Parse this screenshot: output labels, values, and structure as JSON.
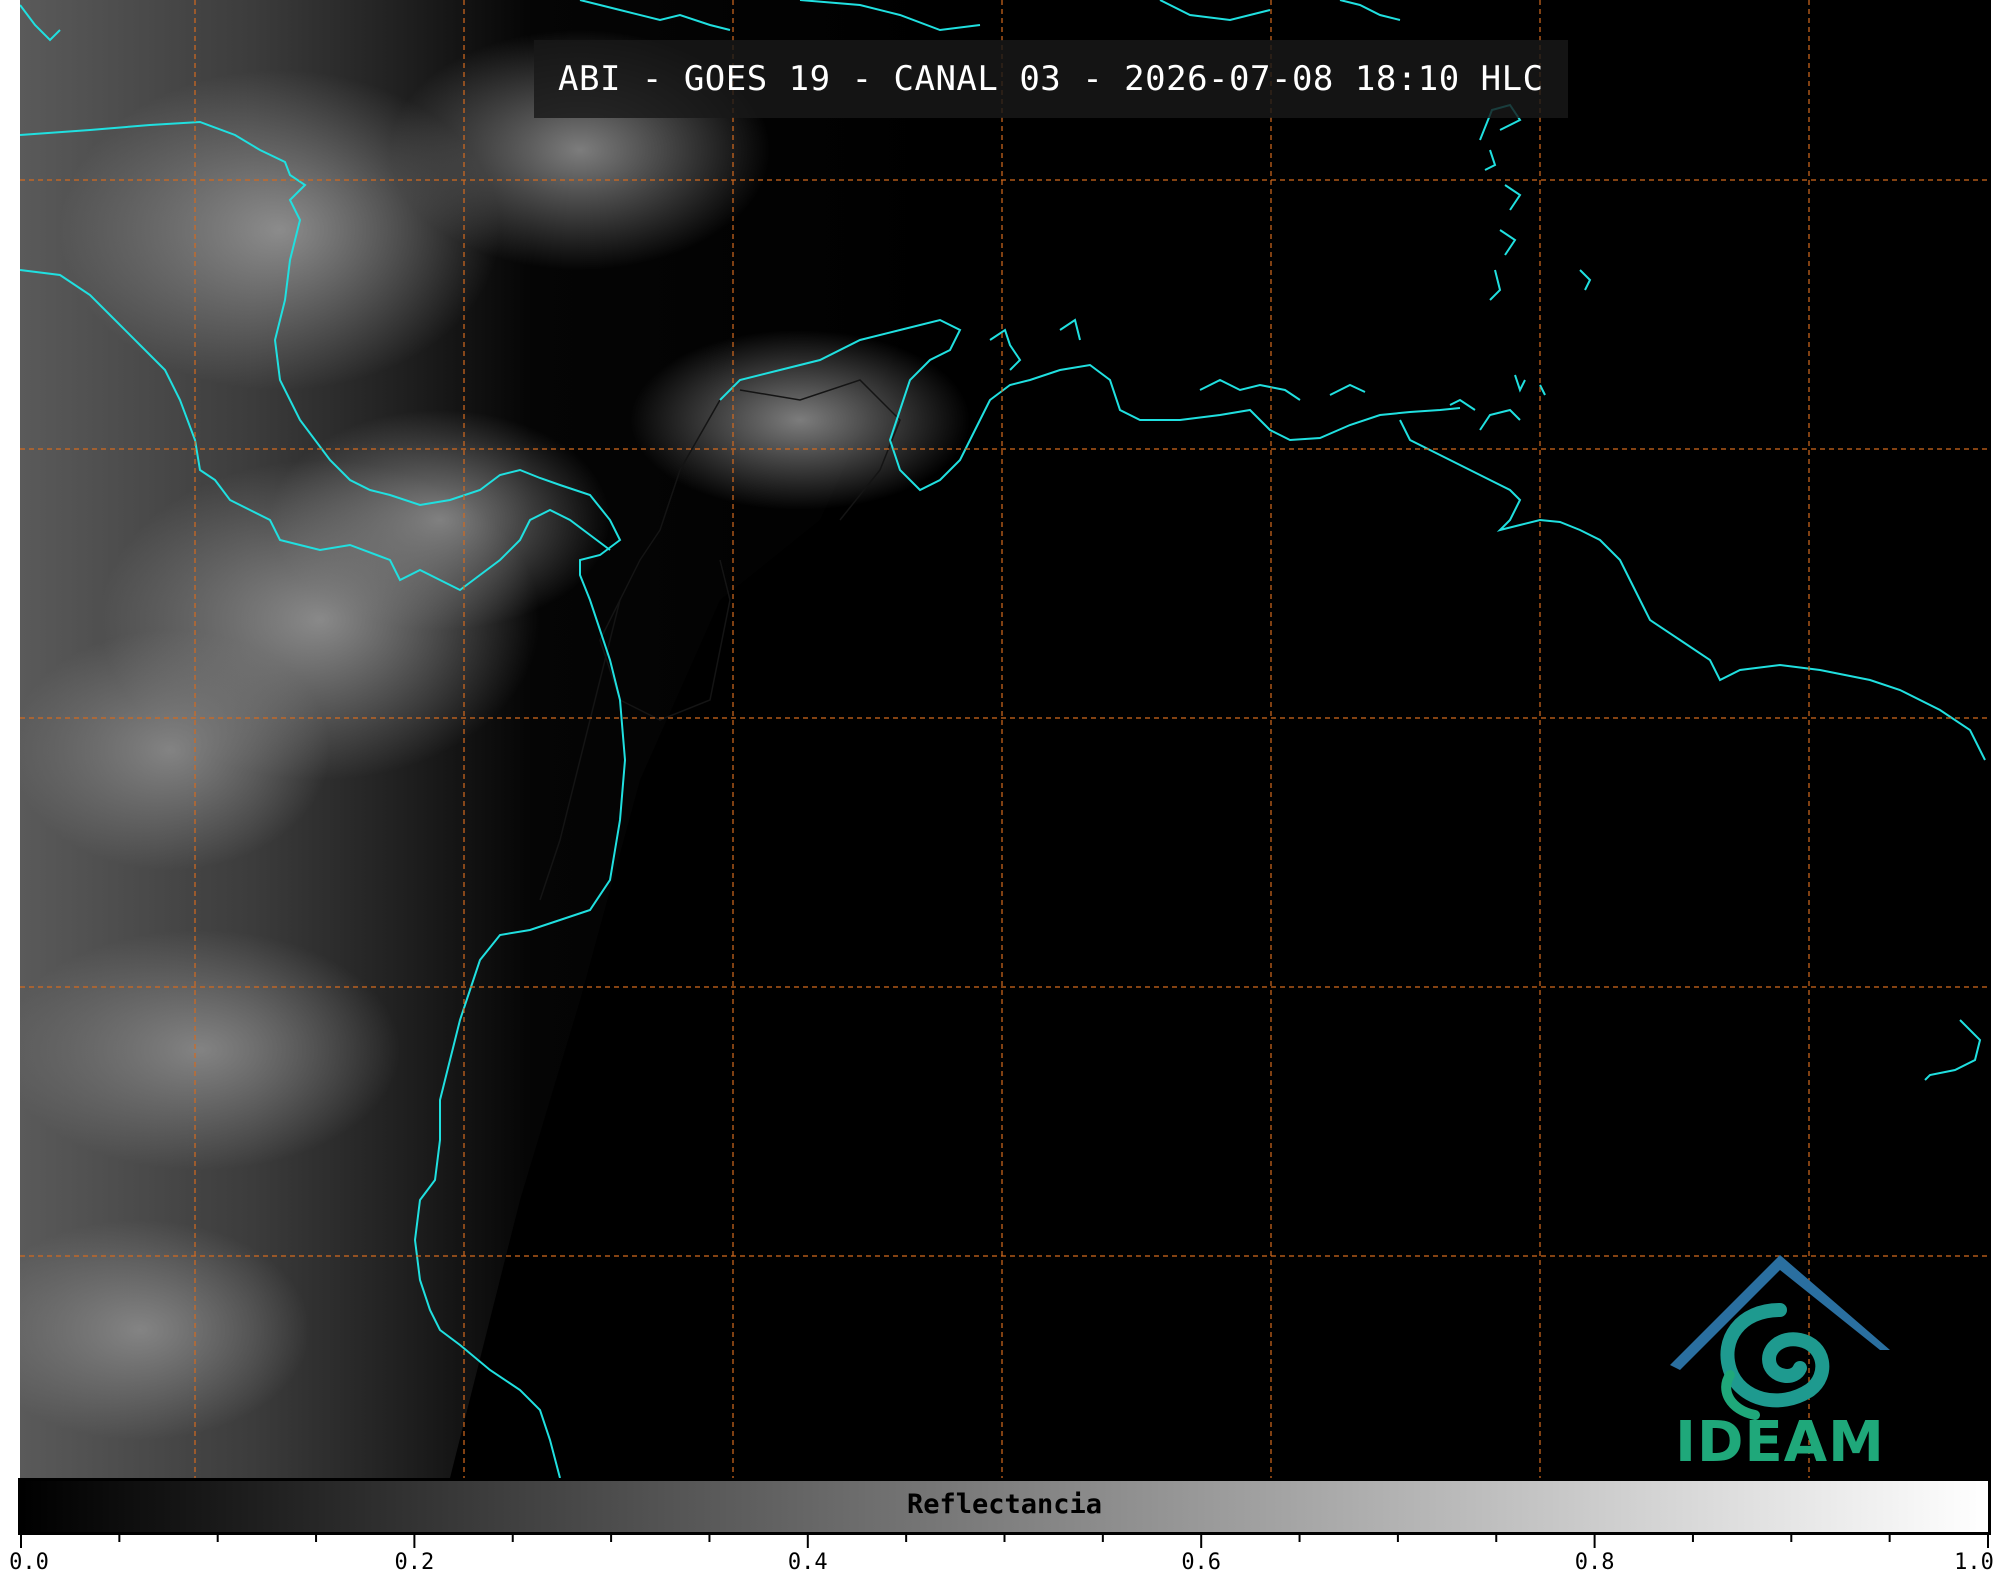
{
  "title": "ABI - GOES 19 - CANAL 03 - 2026-07-08 18:10 HLC",
  "colorbar": {
    "label": "Reflectancia",
    "min": 0.0,
    "max": 1.0,
    "ticks": [
      {
        "value": 0.0,
        "label": "0.0"
      },
      {
        "value": 0.2,
        "label": "0.2"
      },
      {
        "value": 0.4,
        "label": "0.4"
      },
      {
        "value": 0.6,
        "label": "0.6"
      },
      {
        "value": 0.8,
        "label": "0.8"
      },
      {
        "value": 1.0,
        "label": "1.0"
      }
    ],
    "minor_step": 0.05
  },
  "logo": {
    "text": "IDEAM",
    "text_color": "#1fa87a",
    "roof_color": "#2a6fa0",
    "swirl_color": "#1e9a8f"
  },
  "colors": {
    "coastline": "#20e0e0",
    "gridline": "#d46a1e",
    "borders": "#111111",
    "background": "#000000"
  },
  "map": {
    "grid": "dashed",
    "imagery": "visible reflectance",
    "cloud_tone": "gray"
  }
}
